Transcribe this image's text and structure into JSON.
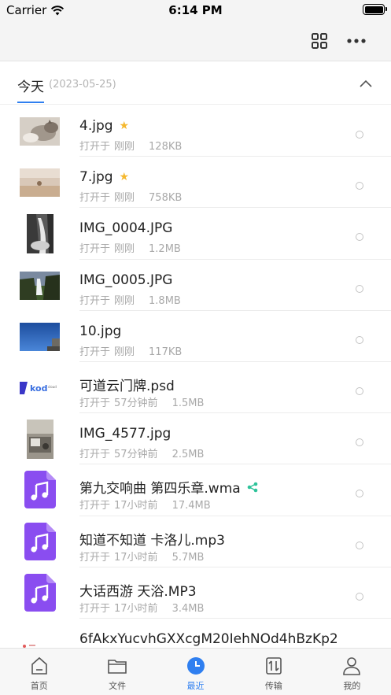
{
  "status_bar": {
    "carrier": "Carrier",
    "time": "6:14 PM",
    "battery_level": 1.0
  },
  "nav": {
    "grid_icon": "grid-view-icon",
    "more_icon": "more-horizontal-icon"
  },
  "section": {
    "title": "今天",
    "date": "(2023-05-25)",
    "collapse_icon": "chevron-up-icon"
  },
  "files": [
    {
      "name": "4.jpg",
      "opened_prefix": "打开于",
      "opened": "刚刚",
      "size": "128KB",
      "starred": true,
      "shared": false,
      "thumb": "cat-photo",
      "thumb_shape": "wide"
    },
    {
      "name": "7.jpg",
      "opened_prefix": "打开于",
      "opened": "刚刚",
      "size": "758KB",
      "starred": true,
      "shared": false,
      "thumb": "beach-photo",
      "thumb_shape": "wide"
    },
    {
      "name": "IMG_0004.JPG",
      "opened_prefix": "打开于",
      "opened": "刚刚",
      "size": "1.2MB",
      "starred": false,
      "shared": false,
      "thumb": "waterfall-bw-photo",
      "thumb_shape": "tall"
    },
    {
      "name": "IMG_0005.JPG",
      "opened_prefix": "打开于",
      "opened": "刚刚",
      "size": "1.8MB",
      "starred": false,
      "shared": false,
      "thumb": "waterfall-photo",
      "thumb_shape": "wide"
    },
    {
      "name": "10.jpg",
      "opened_prefix": "打开于",
      "opened": "刚刚",
      "size": "117KB",
      "starred": false,
      "shared": false,
      "thumb": "sky-photo",
      "thumb_shape": "wide"
    },
    {
      "name": "可道云门牌.psd",
      "opened_prefix": "打开于",
      "opened": "57分钟前",
      "size": "1.5MB",
      "starred": false,
      "shared": false,
      "thumb": "kod-logo-image",
      "thumb_shape": "wide"
    },
    {
      "name": "IMG_4577.jpg",
      "opened_prefix": "打开于",
      "opened": "57分钟前",
      "size": "2.5MB",
      "starred": false,
      "shared": false,
      "thumb": "desk-photo",
      "thumb_shape": "tall"
    },
    {
      "name": "第九交响曲 第四乐章.wma",
      "opened_prefix": "打开于",
      "opened": "17小时前",
      "size": "17.4MB",
      "starred": false,
      "shared": true,
      "thumb": "music-file-icon",
      "thumb_shape": "doc"
    },
    {
      "name": "知道不知道 卡洛儿.mp3",
      "opened_prefix": "打开于",
      "opened": "17小时前",
      "size": "5.7MB",
      "starred": false,
      "shared": false,
      "thumb": "music-file-icon",
      "thumb_shape": "doc"
    },
    {
      "name": "大话西游 天浴.MP3",
      "opened_prefix": "打开于",
      "opened": "17小时前",
      "size": "3.4MB",
      "starred": false,
      "shared": false,
      "thumb": "music-file-icon",
      "thumb_shape": "doc"
    },
    {
      "name": "6fAkxYucvhGXXcgM20IehNOd4hBzKp2",
      "opened_prefix": "",
      "opened": "",
      "size": "",
      "starred": false,
      "shared": false,
      "thumb": "partial-image",
      "thumb_shape": "wide"
    }
  ],
  "tabs": [
    {
      "label": "首页",
      "icon": "home-icon",
      "active": false
    },
    {
      "label": "文件",
      "icon": "folder-icon",
      "active": false
    },
    {
      "label": "最近",
      "icon": "clock-icon",
      "active": true
    },
    {
      "label": "传输",
      "icon": "transfer-icon",
      "active": false
    },
    {
      "label": "我的",
      "icon": "user-icon",
      "active": false
    }
  ],
  "colors": {
    "accent": "#2f7ff0",
    "star": "#f5b82e",
    "share": "#2ec39a",
    "music": "#8a4df0"
  }
}
